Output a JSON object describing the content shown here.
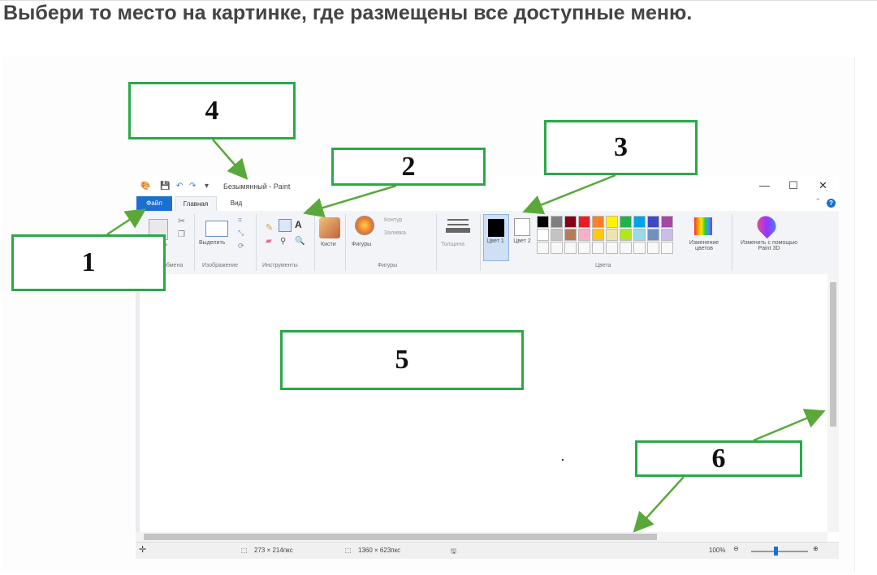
{
  "question": "Выбери то место на картинке, где размещены все доступные меню.",
  "window": {
    "title": "Безымянный - Paint",
    "controls": {
      "minimize": "—",
      "maximize": "☐",
      "close": "✕"
    }
  },
  "tabs": {
    "file": "Файл",
    "home": "Главная",
    "view": "Вид"
  },
  "ribbon": {
    "clipboard_label": "обмена",
    "clipboard_paste": "ть",
    "image_label": "Изображение",
    "select": "Выделить",
    "tools_label": "Инструменты",
    "brushes": "Кисти",
    "shapes": "Фигуры",
    "shapes_label": "Фигуры",
    "outline": "Контур",
    "fill": "Заливка",
    "size": "Толщина",
    "color1": "Цвет 1",
    "color2": "Цвет 2",
    "colors_label": "Цвета",
    "edit_colors": "Изменение цветов",
    "paint3d": "Изменить с помощью Paint 3D"
  },
  "palette_top": [
    "#000000",
    "#7f7f7f",
    "#880015",
    "#ed1c24",
    "#ff7f27",
    "#fff200",
    "#22b14c",
    "#00a2e8",
    "#3f48cc",
    "#a349a4"
  ],
  "palette_mid": [
    "#ffffff",
    "#c3c3c3",
    "#b97a57",
    "#ffaec9",
    "#ffc90e",
    "#efe4b0",
    "#b5e61d",
    "#99d9ea",
    "#7092be",
    "#c8bfe7"
  ],
  "status": {
    "selection_size": "273 × 214пкс",
    "canvas_size": "1360 × 623пкс",
    "zoom": "100%"
  },
  "callouts": [
    "4",
    "2",
    "3",
    "1",
    "5",
    "6"
  ],
  "colors": {
    "callout_green": "#2aa84a",
    "accent_blue": "#1a6fd1"
  }
}
